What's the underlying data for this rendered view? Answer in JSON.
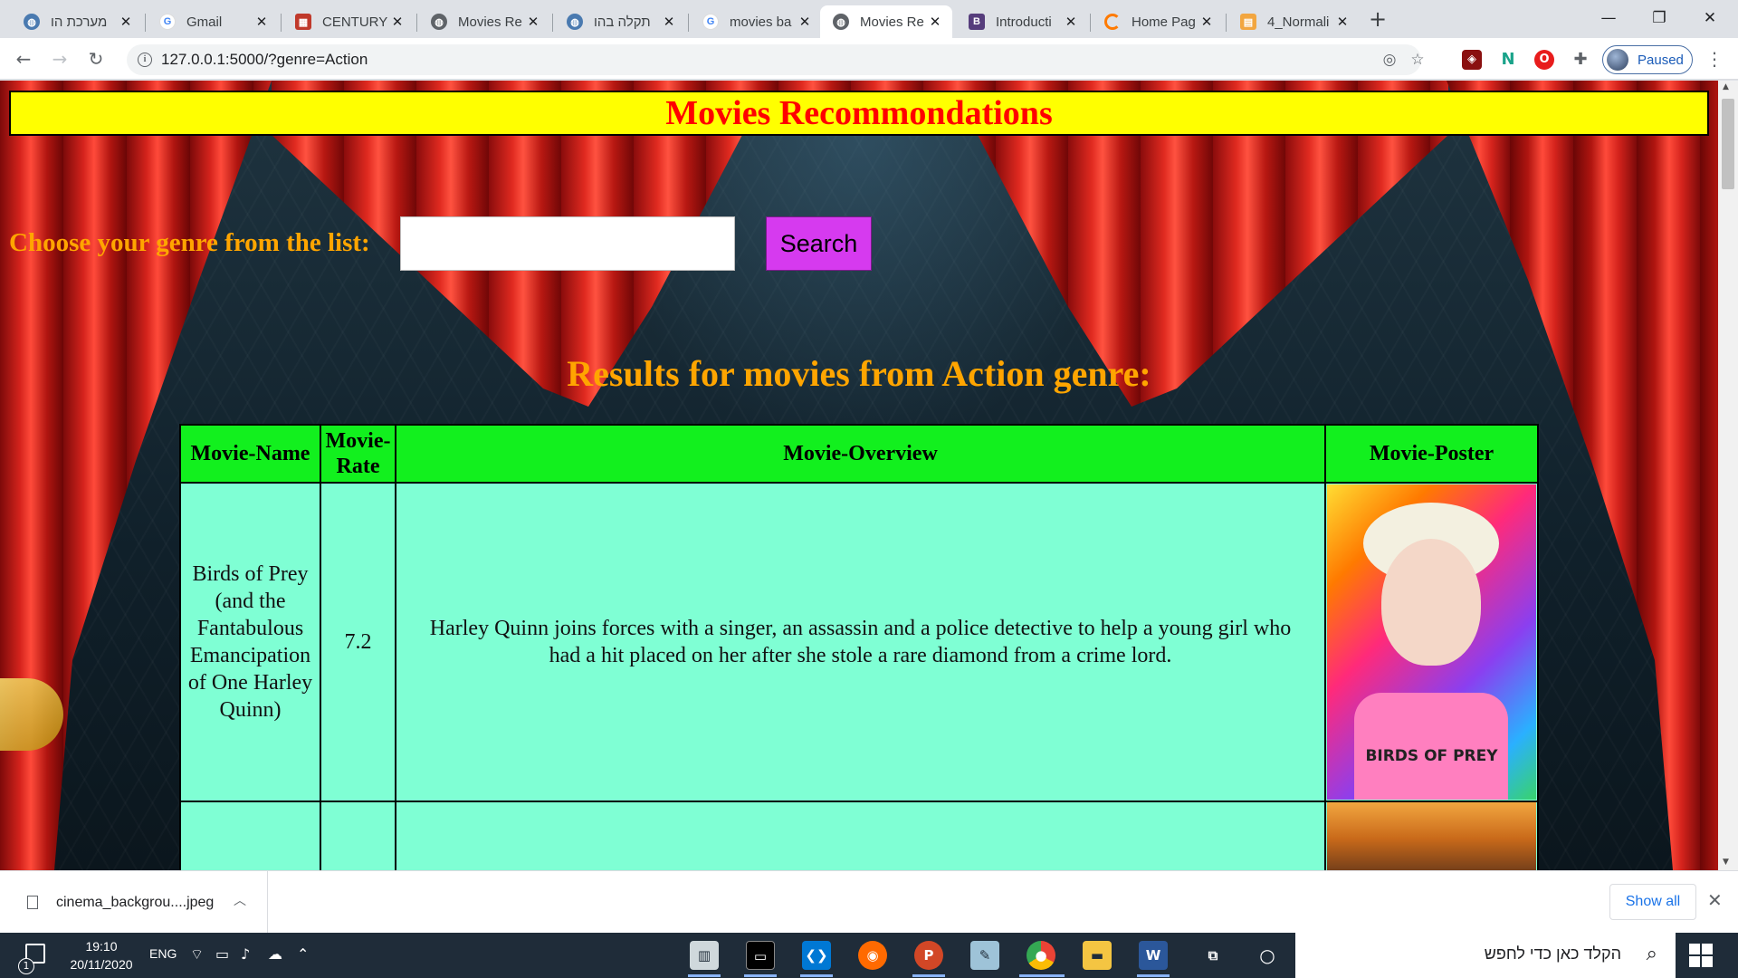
{
  "browser": {
    "tabs": [
      {
        "title": "מערכת הו",
        "favicon": "globe-icon",
        "color": "#4a7ab0"
      },
      {
        "title": "Gmail",
        "favicon": "google-icon",
        "color": "#4285f4"
      },
      {
        "title": "CENTURY",
        "favicon": "century-icon",
        "color": "#c0392b"
      },
      {
        "title": "Movies Re",
        "favicon": "globe-icon",
        "color": "#5f6368"
      },
      {
        "title": "תקלה בהו",
        "favicon": "globe-icon",
        "color": "#4a7ab0"
      },
      {
        "title": "movies ba",
        "favicon": "google-icon",
        "color": "#4285f4"
      },
      {
        "title": "Movies Re",
        "favicon": "globe-icon",
        "color": "#5f6368",
        "active": true
      },
      {
        "title": "Introducti",
        "favicon": "bootstrap-icon",
        "color": "#563d7c"
      },
      {
        "title": "Home Pag",
        "favicon": "loading-icon",
        "color": "#ff7a00"
      },
      {
        "title": "4_Normali",
        "favicon": "book-icon",
        "color": "#f2a640"
      }
    ],
    "url": "127.0.0.1:5000/?genre=Action",
    "profile_status": "Paused"
  },
  "page": {
    "header_title": "Movies Recommondations",
    "genre_label": "Choose your genre from the list:",
    "genre_input_value": "",
    "search_button_label": "Search",
    "results_title": "Results for movies from Action genre:",
    "table": {
      "columns": [
        "Movie-Name",
        "Movie-Rate",
        "Movie-Overview",
        "Movie-Poster"
      ],
      "rows": [
        {
          "name": "Birds of Prey (and the Fantabulous Emancipation of One Harley Quinn)",
          "rate": "7.2",
          "overview": "Harley Quinn joins forces with a singer, an assassin and a police detective to help a young girl who had a hit placed on her after she stole a rare diamond from a crime lord.",
          "poster_title": "BIRDS OF PREY"
        },
        {
          "name": "",
          "rate": "",
          "overview": "",
          "poster_title": ""
        }
      ]
    }
  },
  "downloads": {
    "file_name": "cinema_backgrou....jpeg",
    "show_all_label": "Show all"
  },
  "taskbar": {
    "time": "19:10",
    "date": "20/11/2020",
    "language": "ENG",
    "notification_count": "1",
    "search_placeholder": "הקלד כאן כדי לחפש"
  }
}
